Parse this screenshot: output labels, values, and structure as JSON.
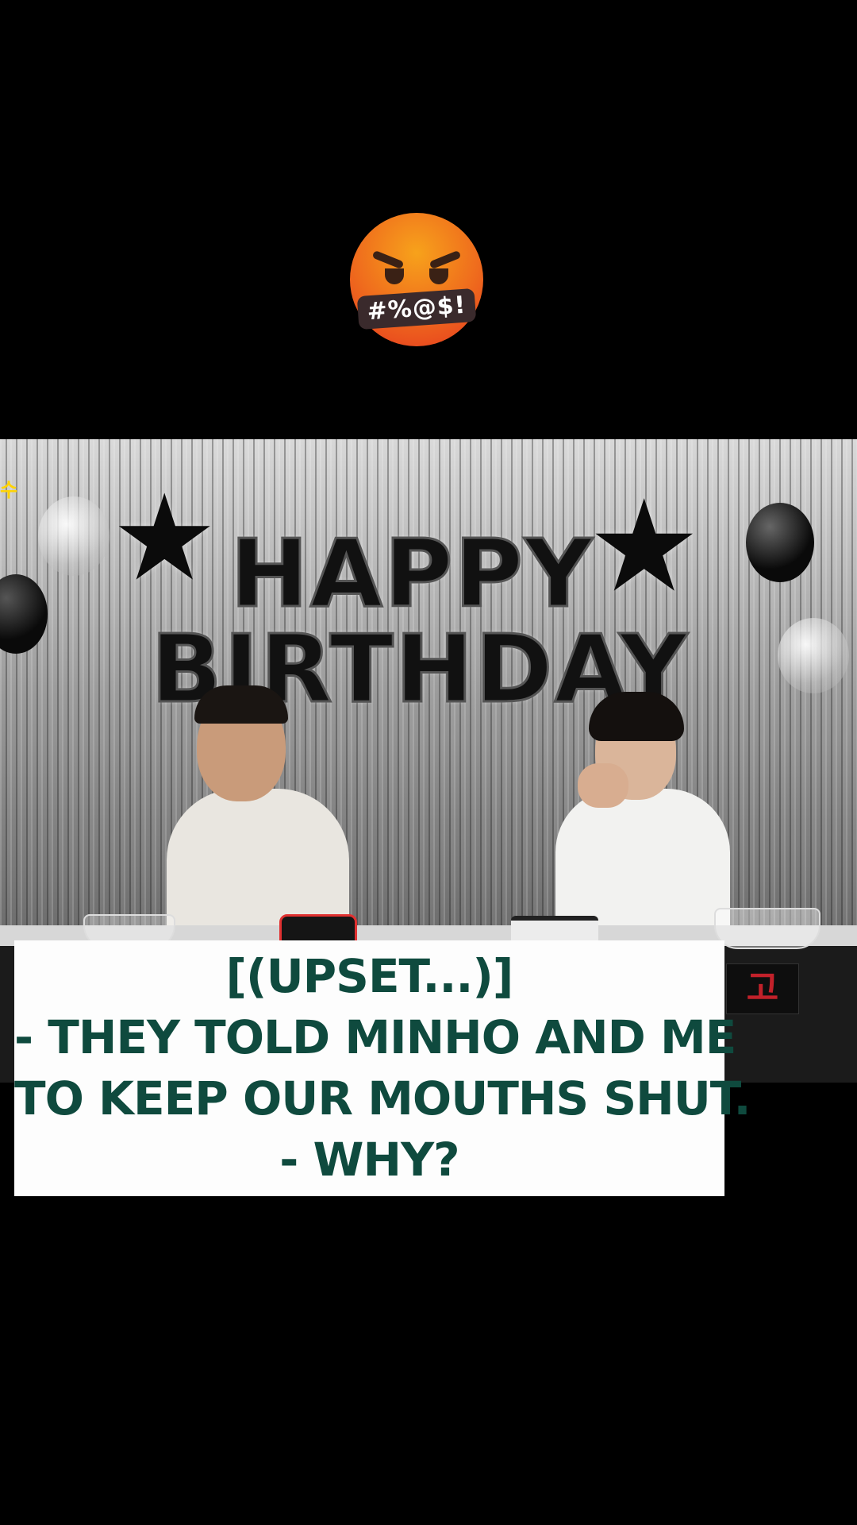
{
  "emoji": {
    "icon": "angry-swearing-face-icon",
    "text": "#%@$!",
    "colors": {
      "top": "#f7a21b",
      "bottom": "#e6391f",
      "bar": "#3a2a2c"
    }
  },
  "scene": {
    "balloon_line1": "HAPPY",
    "balloon_line2": "BIRTHDAY",
    "corner_logo": "수",
    "sign_text": "고"
  },
  "caption": {
    "lines": [
      "[(UPSET...)]",
      "- THEY TOLD MINHO AND ME",
      "TO KEEP OUR MOUTHS SHUT.",
      "- WHY?"
    ],
    "text_color": "#0f4a3e",
    "background": "#fdfdfd"
  }
}
